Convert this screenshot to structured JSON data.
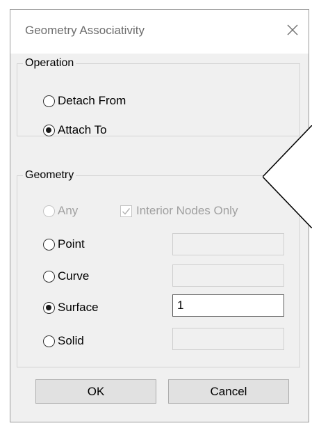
{
  "dialog": {
    "title": "Geometry Associativity",
    "close_glyph": "✕"
  },
  "operation": {
    "legend": "Operation",
    "options": [
      {
        "label": "Detach From",
        "checked": false
      },
      {
        "label": "Attach To",
        "checked": true
      }
    ]
  },
  "geometry": {
    "legend": "Geometry",
    "any_label": "Any",
    "interior_nodes_label": "Interior Nodes Only",
    "interior_nodes_checked": true,
    "options": [
      {
        "label": "Point",
        "checked": false,
        "value": ""
      },
      {
        "label": "Curve",
        "checked": false,
        "value": ""
      },
      {
        "label": "Surface",
        "checked": true,
        "value": "1"
      },
      {
        "label": "Solid",
        "checked": false,
        "value": ""
      }
    ]
  },
  "buttons": {
    "ok": "OK",
    "cancel": "Cancel"
  },
  "colors": {
    "dialog_bg": "#f0f0f0",
    "title_text": "#6c6c6c",
    "disabled_text": "#a0a0a0",
    "button_bg": "#e1e1e1"
  }
}
